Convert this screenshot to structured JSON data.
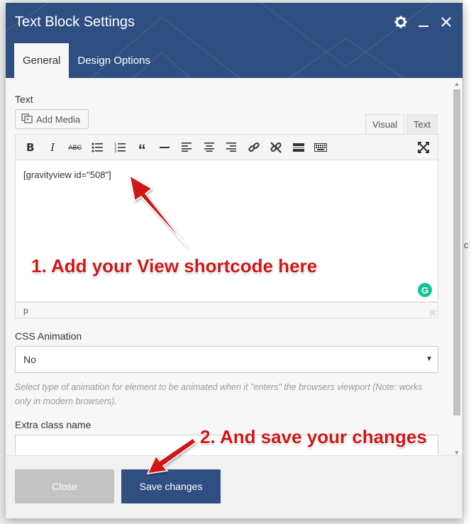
{
  "modal": {
    "title": "Text Block Settings",
    "tabs": [
      "General",
      "Design Options"
    ],
    "header_color": "#2f4f82"
  },
  "text_field": {
    "label": "Text",
    "add_media_label": "Add Media",
    "editor_tabs": [
      "Visual",
      "Text"
    ],
    "toolbar": [
      "bold-icon",
      "italic-icon",
      "strikethrough-icon",
      "bullet-list-icon",
      "numbered-list-icon",
      "blockquote-icon",
      "horizontal-line-icon",
      "align-left-icon",
      "align-center-icon",
      "align-right-icon",
      "insert-link-icon",
      "remove-link-icon",
      "read-more-icon",
      "toolbar-toggle-icon",
      "fullscreen-icon"
    ],
    "content": "[gravityview id=\"508\"]",
    "status_path": "p"
  },
  "css_animation": {
    "label": "CSS Animation",
    "value": "No",
    "help": "Select type of animation for element to be animated when it \"enters\" the browsers viewport (Note: works only in modern browsers)."
  },
  "extra_class": {
    "label": "Extra class name",
    "value": ""
  },
  "footer": {
    "close_label": "Close",
    "save_label": "Save changes"
  },
  "annotations": {
    "step1": "1. Add your View shortcode here",
    "step2": "2. And save your changes",
    "color": "#d21414"
  }
}
